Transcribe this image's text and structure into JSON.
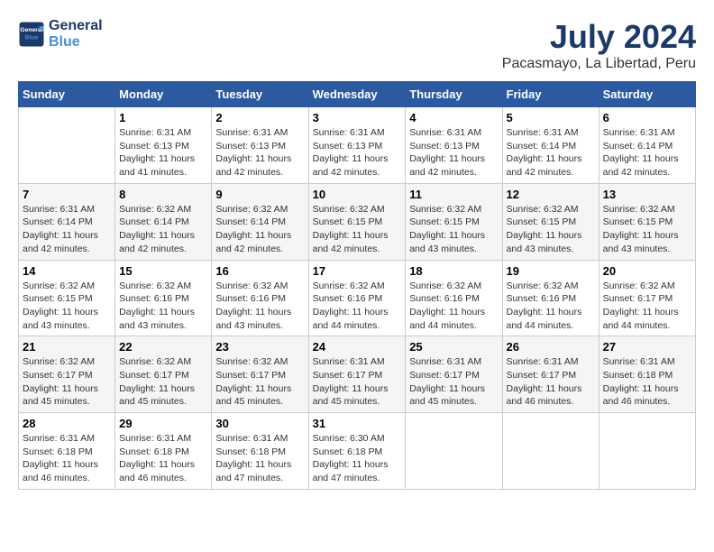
{
  "header": {
    "logo_line1": "General",
    "logo_line2": "Blue",
    "title": "July 2024",
    "subtitle": "Pacasmayo, La Libertad, Peru"
  },
  "calendar": {
    "headers": [
      "Sunday",
      "Monday",
      "Tuesday",
      "Wednesday",
      "Thursday",
      "Friday",
      "Saturday"
    ],
    "weeks": [
      [
        {
          "day": "",
          "info": ""
        },
        {
          "day": "1",
          "info": "Sunrise: 6:31 AM\nSunset: 6:13 PM\nDaylight: 11 hours\nand 41 minutes."
        },
        {
          "day": "2",
          "info": "Sunrise: 6:31 AM\nSunset: 6:13 PM\nDaylight: 11 hours\nand 42 minutes."
        },
        {
          "day": "3",
          "info": "Sunrise: 6:31 AM\nSunset: 6:13 PM\nDaylight: 11 hours\nand 42 minutes."
        },
        {
          "day": "4",
          "info": "Sunrise: 6:31 AM\nSunset: 6:13 PM\nDaylight: 11 hours\nand 42 minutes."
        },
        {
          "day": "5",
          "info": "Sunrise: 6:31 AM\nSunset: 6:14 PM\nDaylight: 11 hours\nand 42 minutes."
        },
        {
          "day": "6",
          "info": "Sunrise: 6:31 AM\nSunset: 6:14 PM\nDaylight: 11 hours\nand 42 minutes."
        }
      ],
      [
        {
          "day": "7",
          "info": "Sunrise: 6:31 AM\nSunset: 6:14 PM\nDaylight: 11 hours\nand 42 minutes."
        },
        {
          "day": "8",
          "info": "Sunrise: 6:32 AM\nSunset: 6:14 PM\nDaylight: 11 hours\nand 42 minutes."
        },
        {
          "day": "9",
          "info": "Sunrise: 6:32 AM\nSunset: 6:14 PM\nDaylight: 11 hours\nand 42 minutes."
        },
        {
          "day": "10",
          "info": "Sunrise: 6:32 AM\nSunset: 6:15 PM\nDaylight: 11 hours\nand 42 minutes."
        },
        {
          "day": "11",
          "info": "Sunrise: 6:32 AM\nSunset: 6:15 PM\nDaylight: 11 hours\nand 43 minutes."
        },
        {
          "day": "12",
          "info": "Sunrise: 6:32 AM\nSunset: 6:15 PM\nDaylight: 11 hours\nand 43 minutes."
        },
        {
          "day": "13",
          "info": "Sunrise: 6:32 AM\nSunset: 6:15 PM\nDaylight: 11 hours\nand 43 minutes."
        }
      ],
      [
        {
          "day": "14",
          "info": "Sunrise: 6:32 AM\nSunset: 6:15 PM\nDaylight: 11 hours\nand 43 minutes."
        },
        {
          "day": "15",
          "info": "Sunrise: 6:32 AM\nSunset: 6:16 PM\nDaylight: 11 hours\nand 43 minutes."
        },
        {
          "day": "16",
          "info": "Sunrise: 6:32 AM\nSunset: 6:16 PM\nDaylight: 11 hours\nand 43 minutes."
        },
        {
          "day": "17",
          "info": "Sunrise: 6:32 AM\nSunset: 6:16 PM\nDaylight: 11 hours\nand 44 minutes."
        },
        {
          "day": "18",
          "info": "Sunrise: 6:32 AM\nSunset: 6:16 PM\nDaylight: 11 hours\nand 44 minutes."
        },
        {
          "day": "19",
          "info": "Sunrise: 6:32 AM\nSunset: 6:16 PM\nDaylight: 11 hours\nand 44 minutes."
        },
        {
          "day": "20",
          "info": "Sunrise: 6:32 AM\nSunset: 6:17 PM\nDaylight: 11 hours\nand 44 minutes."
        }
      ],
      [
        {
          "day": "21",
          "info": "Sunrise: 6:32 AM\nSunset: 6:17 PM\nDaylight: 11 hours\nand 45 minutes."
        },
        {
          "day": "22",
          "info": "Sunrise: 6:32 AM\nSunset: 6:17 PM\nDaylight: 11 hours\nand 45 minutes."
        },
        {
          "day": "23",
          "info": "Sunrise: 6:32 AM\nSunset: 6:17 PM\nDaylight: 11 hours\nand 45 minutes."
        },
        {
          "day": "24",
          "info": "Sunrise: 6:31 AM\nSunset: 6:17 PM\nDaylight: 11 hours\nand 45 minutes."
        },
        {
          "day": "25",
          "info": "Sunrise: 6:31 AM\nSunset: 6:17 PM\nDaylight: 11 hours\nand 45 minutes."
        },
        {
          "day": "26",
          "info": "Sunrise: 6:31 AM\nSunset: 6:17 PM\nDaylight: 11 hours\nand 46 minutes."
        },
        {
          "day": "27",
          "info": "Sunrise: 6:31 AM\nSunset: 6:18 PM\nDaylight: 11 hours\nand 46 minutes."
        }
      ],
      [
        {
          "day": "28",
          "info": "Sunrise: 6:31 AM\nSunset: 6:18 PM\nDaylight: 11 hours\nand 46 minutes."
        },
        {
          "day": "29",
          "info": "Sunrise: 6:31 AM\nSunset: 6:18 PM\nDaylight: 11 hours\nand 46 minutes."
        },
        {
          "day": "30",
          "info": "Sunrise: 6:31 AM\nSunset: 6:18 PM\nDaylight: 11 hours\nand 47 minutes."
        },
        {
          "day": "31",
          "info": "Sunrise: 6:30 AM\nSunset: 6:18 PM\nDaylight: 11 hours\nand 47 minutes."
        },
        {
          "day": "",
          "info": ""
        },
        {
          "day": "",
          "info": ""
        },
        {
          "day": "",
          "info": ""
        }
      ]
    ]
  }
}
